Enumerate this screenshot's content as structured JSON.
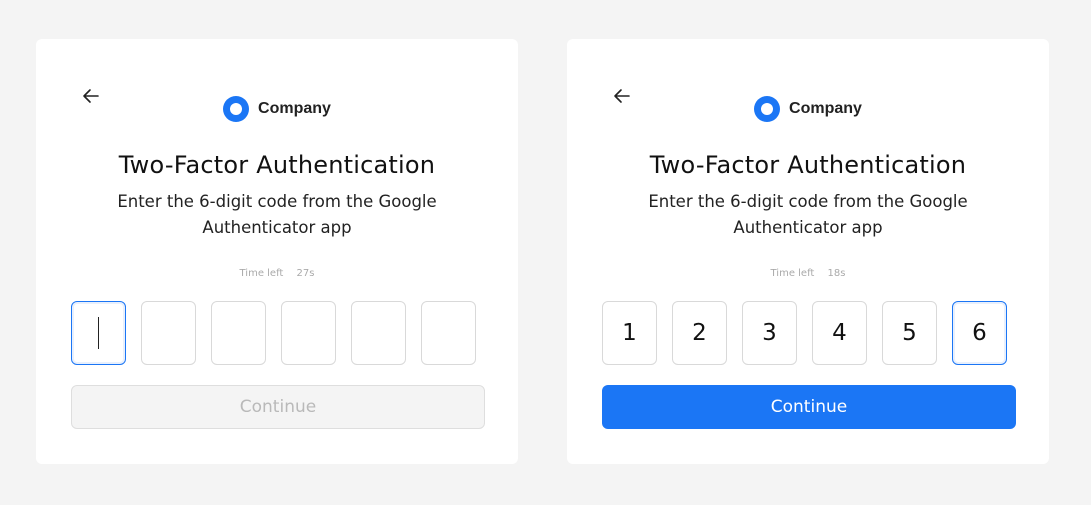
{
  "colors": {
    "accent": "#1b76f5",
    "background": "#f4f4f4",
    "card": "#ffffff"
  },
  "left_card": {
    "back_icon": "arrow-left-icon",
    "brand_name": "Company",
    "title": "Two-Factor Authentication",
    "subtitle": "Enter the 6-digit code from the Google Authenticator app",
    "timer_label": "Time left",
    "timer_value": "27s",
    "digits": [
      "",
      "",
      "",
      "",
      "",
      ""
    ],
    "active_index": 0,
    "continue_label": "Continue",
    "continue_state": "disabled"
  },
  "right_card": {
    "back_icon": "arrow-left-icon",
    "brand_name": "Company",
    "title": "Two-Factor Authentication",
    "subtitle": "Enter the 6-digit code from the Google Authenticator app",
    "timer_label": "Time left",
    "timer_value": "18s",
    "digits": [
      "1",
      "2",
      "3",
      "4",
      "5",
      "6"
    ],
    "active_index": 5,
    "continue_label": "Continue",
    "continue_state": "enabled"
  }
}
